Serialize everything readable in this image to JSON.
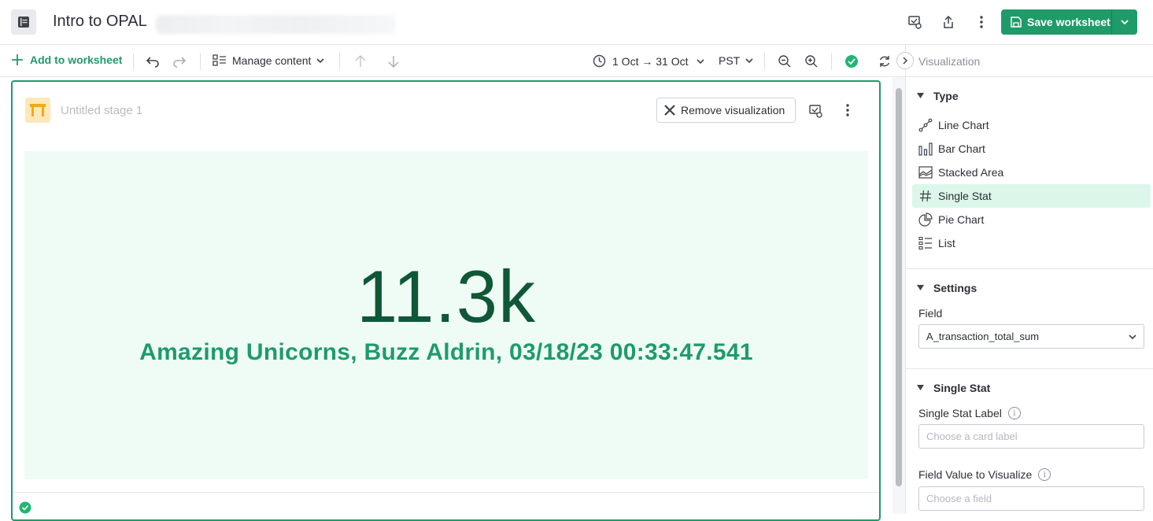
{
  "header": {
    "title": "Intro to OPAL",
    "save_label": "Save worksheet"
  },
  "toolbar": {
    "add_label": "Add to worksheet",
    "manage_label": "Manage content",
    "time_range": "1 Oct → 31 Oct",
    "timezone": "PST"
  },
  "stage": {
    "name": "Untitled stage 1",
    "remove_label": "Remove visualization",
    "stat_value": "11.3k",
    "stat_label": "Amazing Unicorns, Buzz Aldrin, 03/18/23 00:33:47.541"
  },
  "panel": {
    "title": "Visualization",
    "type_section": "Type",
    "types": [
      {
        "label": "Line Chart",
        "icon": "line-chart-icon"
      },
      {
        "label": "Bar Chart",
        "icon": "bar-chart-icon"
      },
      {
        "label": "Stacked Area",
        "icon": "stacked-area-icon"
      },
      {
        "label": "Single Stat",
        "icon": "hash-icon",
        "active": true
      },
      {
        "label": "Pie Chart",
        "icon": "pie-chart-icon"
      },
      {
        "label": "List",
        "icon": "list-icon"
      }
    ],
    "settings_section": "Settings",
    "field_label": "Field",
    "field_value": "A_transaction_total_sum",
    "single_stat_section": "Single Stat",
    "stat_label_label": "Single Stat Label",
    "stat_label_placeholder": "Choose a card label",
    "field_visualize_label": "Field Value to Visualize",
    "field_visualize_placeholder": "Choose a field"
  },
  "colors": {
    "accent": "#1f9b6a",
    "stat_bg": "#effcf6",
    "stat_value": "#0f5737",
    "active_item": "#dcf7ea"
  }
}
